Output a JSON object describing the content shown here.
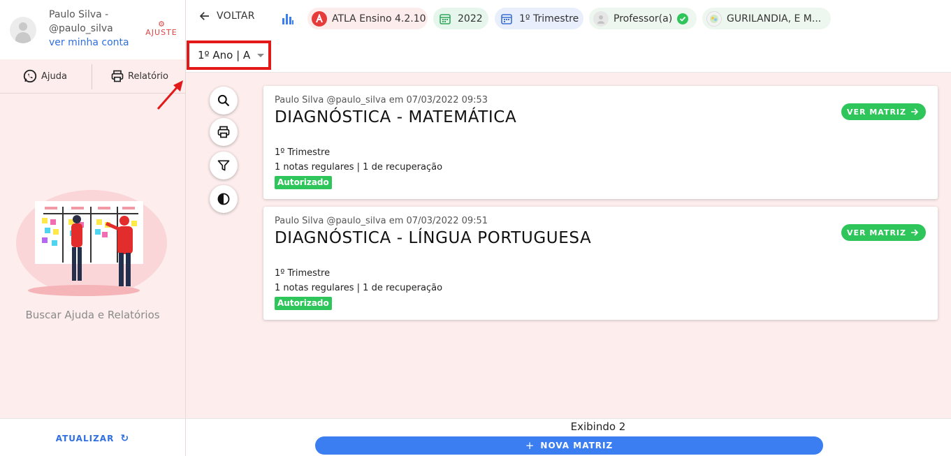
{
  "user": {
    "name_line": "Paulo Silva -",
    "handle": "@paulo_silva",
    "account_link": "ver minha conta",
    "settings_label": "AJUSTE"
  },
  "sidebar": {
    "help_label": "Ajuda",
    "report_label": "Relatório",
    "help_text": "Buscar Ajuda e Relatórios",
    "refresh_label": "ATUALIZAR"
  },
  "topbar": {
    "back_label": "VOLTAR",
    "chips": {
      "app": "ATLA Ensino 4.2.10",
      "year": "2022",
      "term": "1º Trimestre",
      "role": "Professor(a)",
      "school": "GURILANDIA, E M..."
    },
    "class_selector": "1º Ano | A"
  },
  "cards": [
    {
      "meta": "Paulo Silva @paulo_silva em 07/03/2022 09:53",
      "title": "DIAGNÓSTICA - MATEMÁTICA",
      "term": "1º Trimestre",
      "grades": "1 notas regulares | 1 de recuperação",
      "status": "Autorizado",
      "action": "VER MATRIZ"
    },
    {
      "meta": "Paulo Silva @paulo_silva em 07/03/2022 09:51",
      "title": "DIAGNÓSTICA - LÍNGUA PORTUGUESA",
      "term": "1º Trimestre",
      "grades": "1 notas regulares | 1 de recuperação",
      "status": "Autorizado",
      "action": "VER MATRIZ"
    }
  ],
  "footer": {
    "count_text": "Exibindo 2",
    "new_button": "NOVA MATRIZ"
  },
  "colors": {
    "accent_blue": "#3b7ef2",
    "success_green": "#2ec55b",
    "highlight_red": "#e31919",
    "sidebar_bg": "#fdeded"
  }
}
